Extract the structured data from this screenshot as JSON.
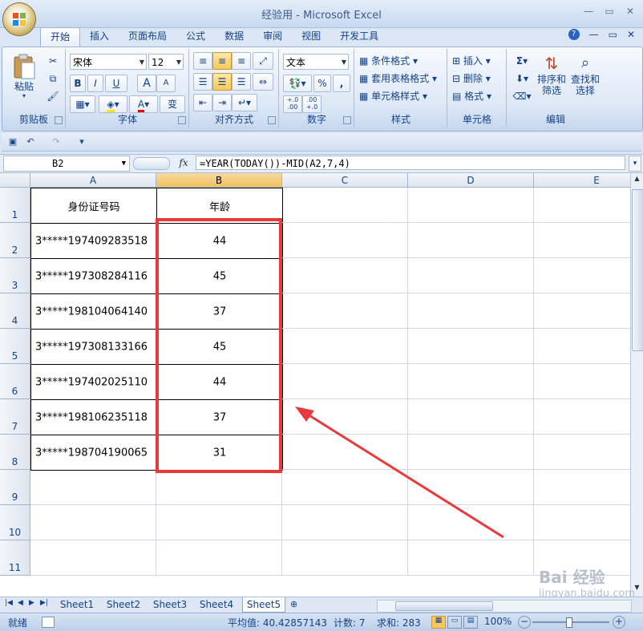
{
  "window": {
    "title": "经验用 - Microsoft Excel"
  },
  "tabs": [
    "开始",
    "插入",
    "页面布局",
    "公式",
    "数据",
    "审阅",
    "视图",
    "开发工具"
  ],
  "active_tab": "开始",
  "ribbon": {
    "clipboard": {
      "paste": "粘贴",
      "label": "剪贴板"
    },
    "font": {
      "name": "宋体",
      "size": "12",
      "bold": "B",
      "italic": "I",
      "underline": "U",
      "grow": "A",
      "shrink": "A",
      "font_color": "A",
      "phonetic": "变",
      "label": "字体"
    },
    "align": {
      "label": "对齐方式"
    },
    "number": {
      "format": "文本",
      "percent": "%",
      "comma": ",",
      "inc_dec": "+.0\n.00",
      "dec_dec": ".00\n+.0",
      "label": "数字"
    },
    "styles": {
      "conditional": "条件格式",
      "table": "套用表格格式",
      "cell": "单元格样式",
      "label": "样式"
    },
    "cells": {
      "insert": "插入",
      "delete": "删除",
      "format": "格式",
      "label": "单元格"
    },
    "editing": {
      "sum": "Σ",
      "sort": "排序和\n筛选",
      "find": "查找和\n选择",
      "label": "编辑"
    }
  },
  "formula_bar": {
    "name_box": "B2",
    "fx": "fx",
    "formula": "=YEAR(TODAY())-MID(A2,7,4)"
  },
  "columns": [
    "A",
    "B",
    "C",
    "D",
    "E"
  ],
  "rows": [
    {
      "num": "1",
      "a": "身份证号码",
      "b": "年龄"
    },
    {
      "num": "2",
      "a": "3*****197409283518",
      "b": "44"
    },
    {
      "num": "3",
      "a": "3*****197308284116",
      "b": "45"
    },
    {
      "num": "4",
      "a": "3*****198104064140",
      "b": "37"
    },
    {
      "num": "5",
      "a": "3*****197308133166",
      "b": "45"
    },
    {
      "num": "6",
      "a": "3*****197402025110",
      "b": "44"
    },
    {
      "num": "7",
      "a": "3*****198106235118",
      "b": "37"
    },
    {
      "num": "8",
      "a": "3*****198704190065",
      "b": "31"
    },
    {
      "num": "9",
      "a": "",
      "b": ""
    },
    {
      "num": "10",
      "a": "",
      "b": ""
    },
    {
      "num": "11",
      "a": "",
      "b": ""
    }
  ],
  "sheets": [
    "Sheet1",
    "Sheet2",
    "Sheet3",
    "Sheet4",
    "Sheet5"
  ],
  "active_sheet": "Sheet5",
  "status": {
    "ready": "就绪",
    "average": "平均值: 40.42857143",
    "count": "计数: 7",
    "sum": "求和: 283",
    "zoom": "100%"
  },
  "watermark": {
    "brand": "Bai 经验",
    "url": "jingyan.baidu.com"
  },
  "colors": {
    "highlight": "#e83a3a",
    "ribbon_bg": "#dbe6f4",
    "selected_header": "#f1c15f"
  }
}
